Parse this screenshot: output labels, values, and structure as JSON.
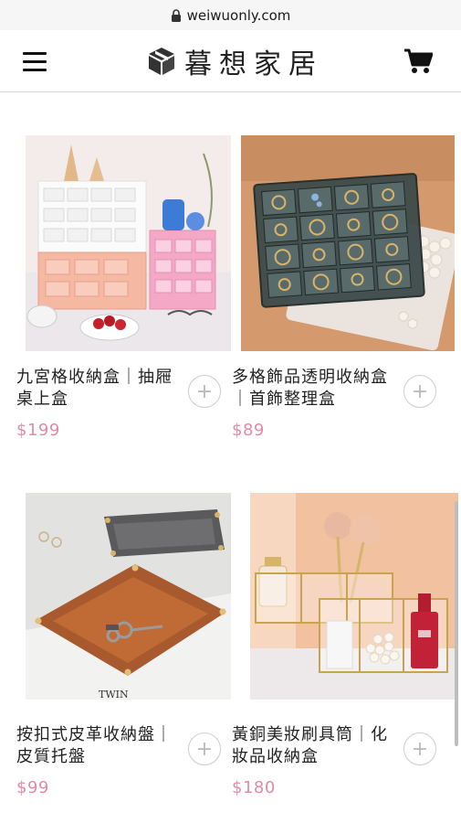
{
  "browser": {
    "url": "weiwuonly.com"
  },
  "header": {
    "brand_name": "暮想家居",
    "menu_icon": "hamburger-menu-icon",
    "cart_icon": "shopping-cart-icon"
  },
  "products": [
    {
      "name": "九宮格收納盒｜抽屜桌上盒",
      "price": "$199",
      "add": "+"
    },
    {
      "name": "多格飾品透明收納盒｜首飾整理盒",
      "price": "$89",
      "add": "+"
    },
    {
      "name": "按扣式皮革收納盤｜皮質托盤",
      "price": "$99",
      "add": "+"
    },
    {
      "name": "黃銅美妝刷具筒｜化妝品收納盒",
      "price": "$180",
      "add": "+"
    }
  ],
  "colors": {
    "price": "#e68aa4",
    "header_border": "#d7d7d7"
  }
}
